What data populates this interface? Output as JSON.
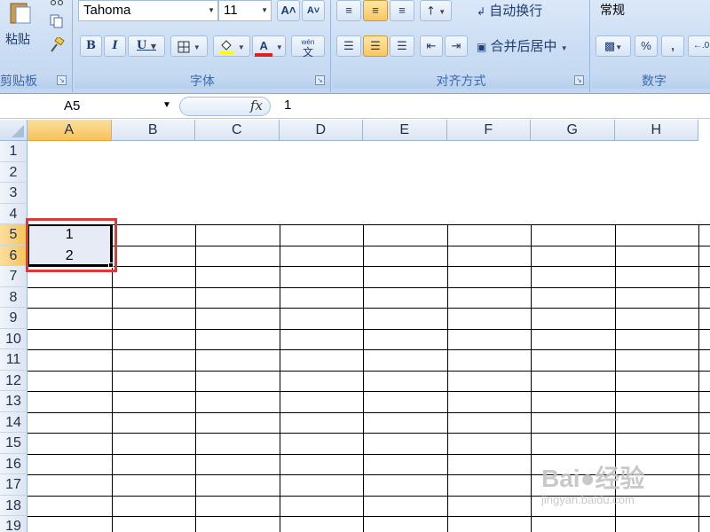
{
  "ribbon": {
    "clipboard": {
      "label": "剪贴板",
      "paste_label": "粘贴",
      "icons": [
        "paste-icon",
        "cut-icon",
        "copy-icon",
        "format-painter-icon"
      ]
    },
    "font": {
      "label": "字体",
      "font_name": "Tahoma",
      "font_size": "11",
      "grow_label": "A˄",
      "shrink_label": "A˅",
      "bold_label": "B",
      "italic_label": "I",
      "underline_label": "U",
      "font_color_label": "A",
      "phonetic_label": "wén",
      "phonetic_char": "文",
      "fill_color": "#ffff00",
      "font_color": "#e02020"
    },
    "alignment": {
      "label": "对齐方式",
      "wrap_text_label": "自动换行",
      "merge_center_label": "合并后居中"
    },
    "number": {
      "label": "数字",
      "format_value": "常规",
      "percent_label": "%",
      "comma_label": ","
    }
  },
  "formula_bar": {
    "name_box": "A5",
    "fx_label": "fx",
    "value": "1"
  },
  "sheet": {
    "columns": [
      "A",
      "B",
      "C",
      "D",
      "E",
      "F",
      "G",
      "H"
    ],
    "rows": [
      "1",
      "2",
      "3",
      "4",
      "5",
      "6",
      "7",
      "8",
      "9",
      "10",
      "11",
      "12",
      "13",
      "14",
      "15",
      "16",
      "17",
      "18",
      "19"
    ],
    "active_column": "A",
    "active_rows": [
      "5",
      "6"
    ],
    "cells": {
      "A5": "1",
      "A6": "2"
    }
  },
  "watermark": {
    "brand": "Bai●经验",
    "url": "jingyan.baidu.com"
  },
  "colors": {
    "ribbon_bg": "#c9dcf3",
    "header_active": "#f7c25a",
    "highlight_box": "#e03838"
  }
}
